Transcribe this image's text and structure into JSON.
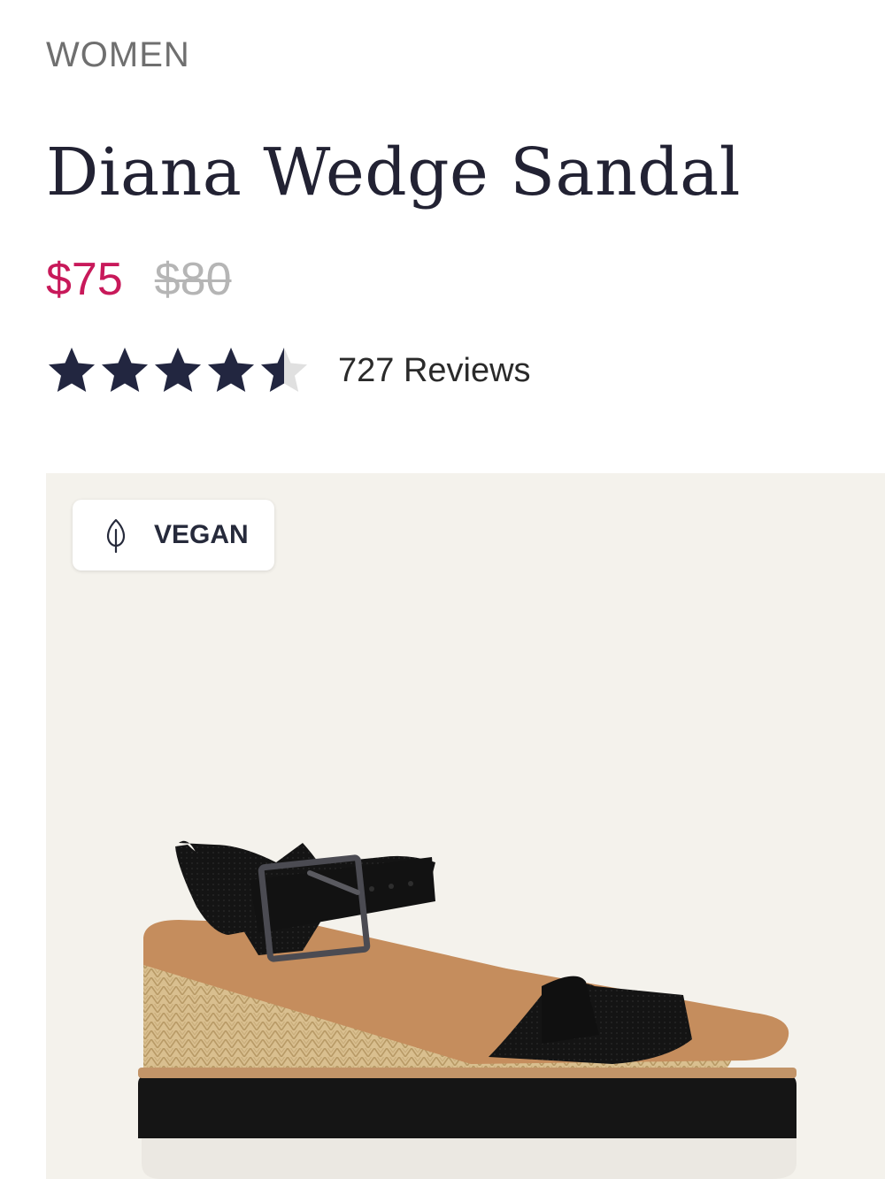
{
  "category": "WOMEN",
  "product": {
    "title": "Diana Wedge Sandal",
    "price_sale": "$75",
    "price_original": "$80",
    "rating": 4.5,
    "rating_max": 5,
    "reviews_label": "727 Reviews"
  },
  "badge": {
    "label": "VEGAN",
    "icon": "leaf-icon"
  },
  "colors": {
    "sale_price": "#c8195a",
    "star": "#222640",
    "image_bg": "#f4f2ec"
  }
}
